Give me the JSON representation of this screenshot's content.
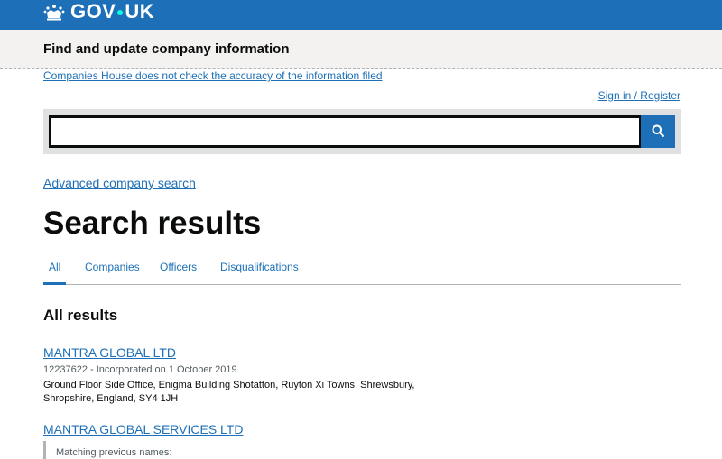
{
  "header": {
    "logo_text_left": "GOV",
    "logo_text_right": "UK"
  },
  "service": {
    "name": "Find and update company information"
  },
  "notice_link": "Companies House does not check the accuracy of the information filed",
  "signin_link": "Sign in / Register",
  "search": {
    "value": "",
    "placeholder": ""
  },
  "advanced_search_link": "Advanced company search",
  "page_title": "Search results",
  "tabs": [
    {
      "label": "All",
      "active": true
    },
    {
      "label": "Companies",
      "active": false
    },
    {
      "label": "Officers",
      "active": false
    },
    {
      "label": "Disqualifications",
      "active": false
    }
  ],
  "section_title": "All results",
  "results": [
    {
      "name": "MANTRA GLOBAL LTD",
      "meta": "12237622 - Incorporated on 1 October 2019",
      "address": "Ground Floor Side Office, Enigma Building Shotatton, Ruyton Xi Towns, Shrewsbury, Shropshire, England, SY4 1JH"
    },
    {
      "name": "MANTRA GLOBAL SERVICES LTD",
      "previous_names_label": "Matching previous names:"
    }
  ],
  "colors": {
    "brand_blue": "#1d70b8",
    "text": "#0b0c0c",
    "secondary_text": "#505a5f",
    "service_bar_bg": "#f3f2f1"
  }
}
